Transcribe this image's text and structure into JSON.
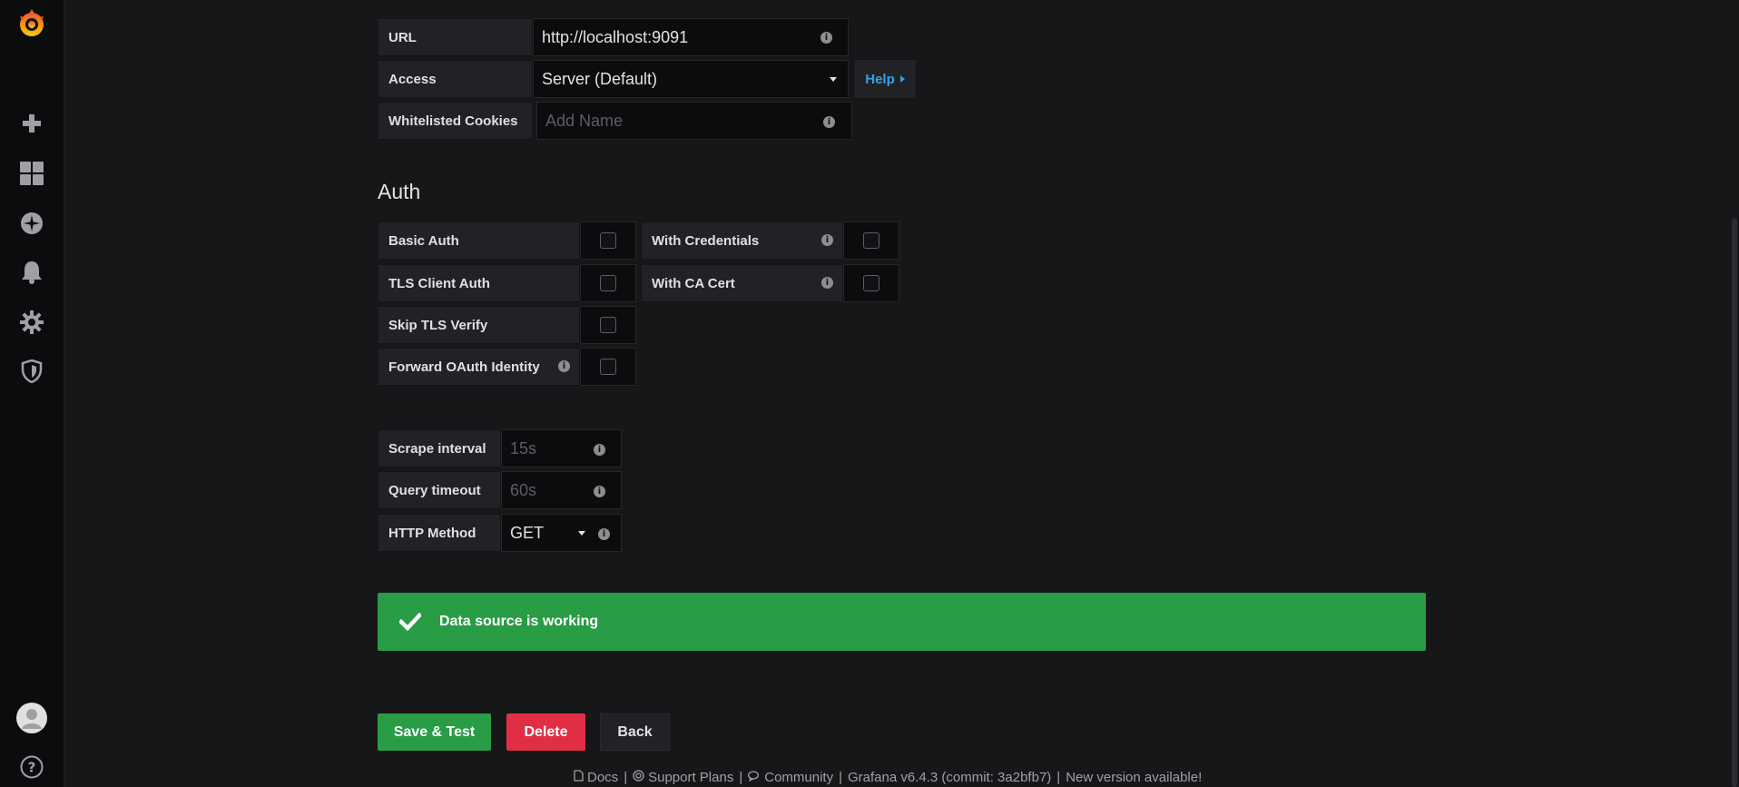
{
  "http": {
    "url_label": "URL",
    "url_value": "http://localhost:9091",
    "access_label": "Access",
    "access_value": "Server (Default)",
    "help_label": "Help",
    "cookies_label": "Whitelisted Cookies",
    "cookies_placeholder": "Add Name"
  },
  "auth": {
    "title": "Auth",
    "basic_auth": "Basic Auth",
    "with_credentials": "With Credentials",
    "tls_client_auth": "TLS Client Auth",
    "with_ca_cert": "With CA Cert",
    "skip_tls_verify": "Skip TLS Verify",
    "forward_oauth": "Forward OAuth Identity"
  },
  "prometheus": {
    "scrape_label": "Scrape interval",
    "scrape_placeholder": "15s",
    "timeout_label": "Query timeout",
    "timeout_placeholder": "60s",
    "method_label": "HTTP Method",
    "method_value": "GET"
  },
  "alert": {
    "message": "Data source is working"
  },
  "buttons": {
    "save_test": "Save & Test",
    "delete": "Delete",
    "back": "Back"
  },
  "footer": {
    "docs": "Docs",
    "support": "Support Plans",
    "community": "Community",
    "version": "Grafana v6.4.3 (commit: 3a2bfb7)",
    "new_version": "New version available!"
  },
  "colors": {
    "success": "#299c46",
    "danger": "#e02f44",
    "link": "#33a2e5"
  }
}
